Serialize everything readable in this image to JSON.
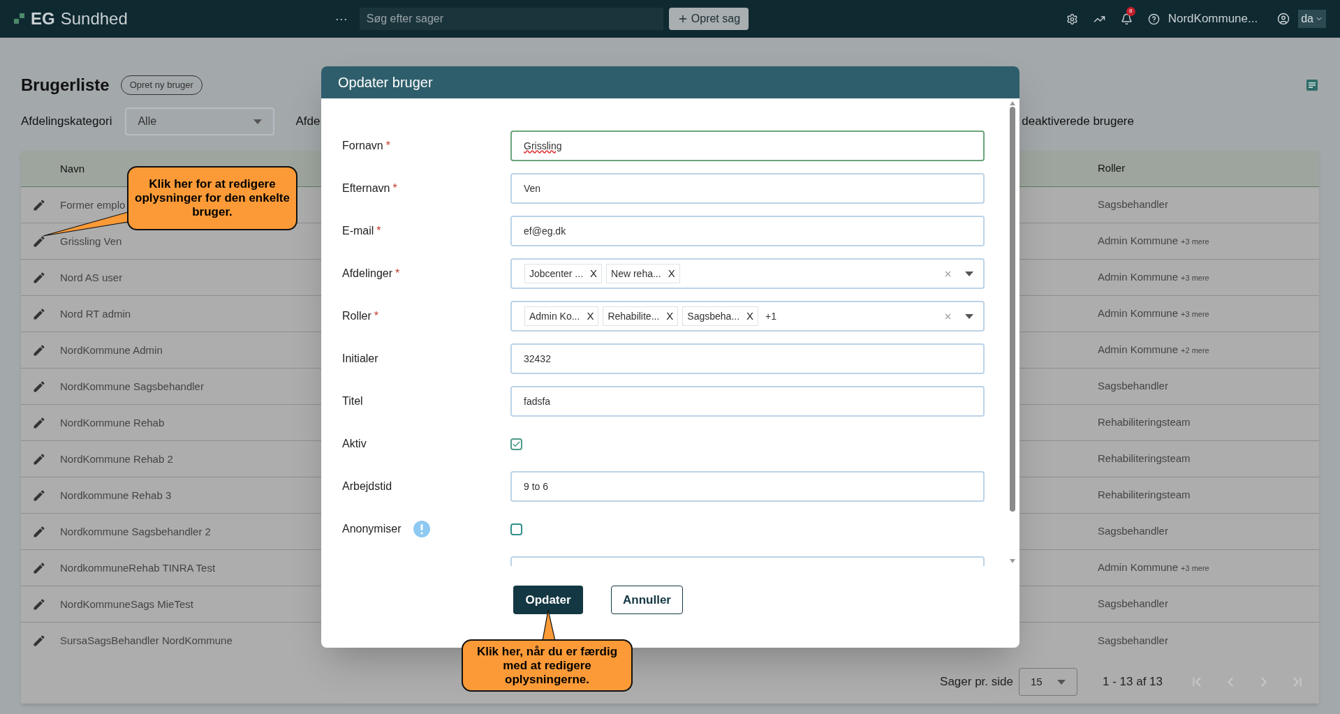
{
  "topbar": {
    "logo": {
      "mark": "EG",
      "name": "Sundhed"
    },
    "more": "···",
    "search": {
      "placeholder": "Søg efter sager"
    },
    "create_button": "Opret sag",
    "notifications": "8",
    "user": "NordKommune...",
    "language": "da"
  },
  "page": {
    "title": "Brugerliste",
    "new_button": "Opret ny bruger"
  },
  "filters": {
    "label": "Afdelingskategori",
    "value": "Alle",
    "cut_label": "Afde",
    "right_label": "deaktiverede brugere"
  },
  "table": {
    "columns": [
      "Navn",
      "Roller"
    ],
    "rows": [
      {
        "name": "Former emplo",
        "role": "Sagsbehandler"
      },
      {
        "name": "Grissling Ven",
        "role": "Admin Kommune",
        "more": "+3 mere"
      },
      {
        "name": "Nord AS user",
        "role": "Admin Kommune",
        "more": "+3 mere"
      },
      {
        "name": "Nord RT admin",
        "role": "Admin Kommune",
        "more": "+3 mere"
      },
      {
        "name": "NordKommune Admin",
        "role": "Admin Kommune",
        "more": "+2 mere"
      },
      {
        "name": "NordKommune Sagsbehandler",
        "role": "Sagsbehandler"
      },
      {
        "name": "NordKommune Rehab",
        "role": "Rehabiliteringsteam"
      },
      {
        "name": "NordKommune Rehab 2",
        "role": "Rehabiliteringsteam"
      },
      {
        "name": "Nordkommune Rehab 3",
        "role": "Rehabiliteringsteam"
      },
      {
        "name": "Nordkommune Sagsbehandler 2",
        "role": "Sagsbehandler"
      },
      {
        "name": "NordkommuneRehab TINRA Test",
        "role": "Admin Kommune",
        "more": "+3 mere"
      },
      {
        "name": "NordKommuneSags MieTest",
        "role": "Sagsbehandler"
      },
      {
        "name": "SursaSagsBehandler NordKommune",
        "role": "Sagsbehandler"
      }
    ]
  },
  "pagination": {
    "label": "Sager pr. side",
    "per_page": "15",
    "range": "1 - 13 af 13"
  },
  "dialog": {
    "title": "Opdater bruger",
    "fields": [
      {
        "kind": "text",
        "label": "Fornavn",
        "required": true,
        "value": "Grissling",
        "focused": true
      },
      {
        "kind": "text",
        "label": "Efternavn",
        "required": true,
        "value": "Ven",
        "focused": false
      },
      {
        "kind": "text",
        "label": "E-mail",
        "required": true,
        "value": "ef@eg.dk",
        "focused": false
      },
      {
        "kind": "multiselect",
        "label": "Afdelinger",
        "required": true,
        "chips": [
          {
            "label": "Jobcenter ...",
            "remove": "X"
          },
          {
            "label": "New reha...",
            "remove": "X"
          }
        ]
      },
      {
        "kind": "multiselect",
        "label": "Roller",
        "required": true,
        "chips": [
          {
            "label": "Admin Ko...",
            "remove": "X"
          },
          {
            "label": "Rehabilite...",
            "remove": "X"
          },
          {
            "label": "Sagsbeha...",
            "remove": "X"
          }
        ],
        "extra": "+1"
      },
      {
        "kind": "text",
        "label": "Initialer",
        "required": false,
        "value": "32432",
        "focused": false
      },
      {
        "kind": "text",
        "label": "Titel",
        "required": false,
        "value": "fadsfa",
        "focused": false
      },
      {
        "kind": "checkbox",
        "label": "Aktiv",
        "checked": true,
        "info": false
      },
      {
        "kind": "text",
        "label": "Arbejdstid",
        "required": false,
        "value": "9 to 6",
        "focused": false
      },
      {
        "kind": "checkbox",
        "label": "Anonymiser",
        "checked": false,
        "info": true
      },
      {
        "kind": "cut"
      }
    ],
    "buttons": [
      "Opdater",
      "Annuller"
    ],
    "required_mark": "*"
  },
  "callouts": [
    "Klik her for at redigere oplysninger for den enkelte bruger.",
    "Klik her, når du er færdig med at redigere oplysningerne."
  ]
}
